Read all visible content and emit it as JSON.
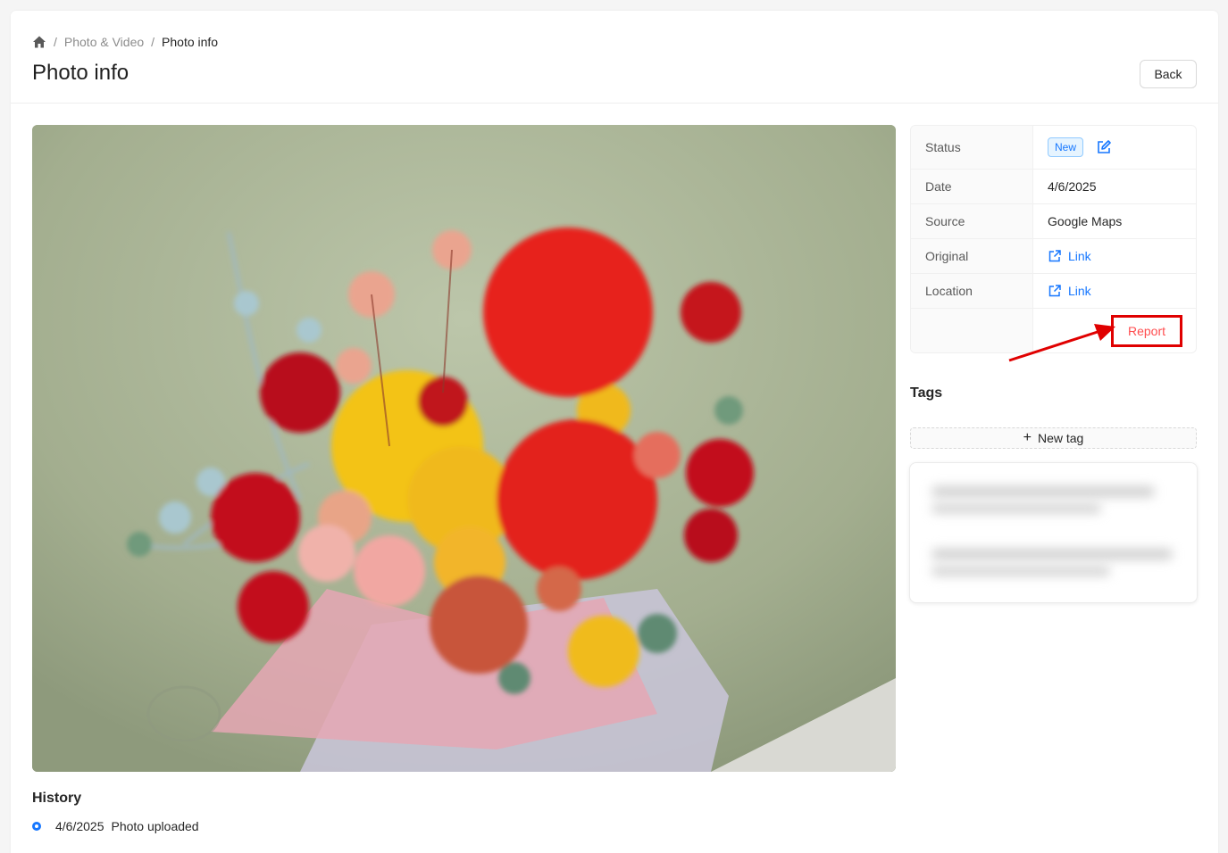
{
  "breadcrumb": {
    "home_icon": "home-icon",
    "parent": "Photo & Video",
    "separator": "/",
    "current": "Photo info"
  },
  "page": {
    "title": "Photo info",
    "back_label": "Back"
  },
  "info": {
    "status_label": "Status",
    "status_value": "New",
    "date_label": "Date",
    "date_value": "4/6/2025",
    "source_label": "Source",
    "source_value": "Google Maps",
    "original_label": "Original",
    "original_link": "Link",
    "location_label": "Location",
    "location_link": "Link",
    "report_label": "Report"
  },
  "tags": {
    "title": "Tags",
    "new_tag_label": "New tag"
  },
  "history": {
    "title": "History",
    "items": [
      {
        "date": "4/6/2025",
        "text": "Photo uploaded"
      }
    ]
  },
  "colors": {
    "accent": "#1677ff",
    "danger": "#ff4d4f",
    "annotation": "#e00000"
  }
}
